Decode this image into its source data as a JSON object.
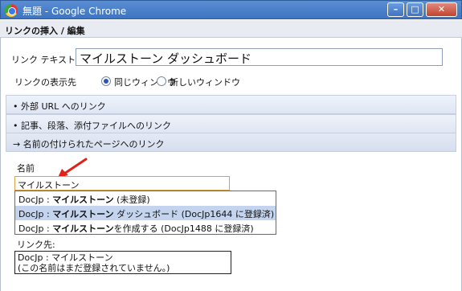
{
  "window": {
    "title": "無題 - Google Chrome",
    "minimize_symbol": "–",
    "maximize_symbol": "□",
    "close_symbol": "✕"
  },
  "dialog": {
    "header": "リンクの挿入 / 編集",
    "link_text_label": "リンク テキスト",
    "link_text_value": "マイルストーン ダッシュボード",
    "display_label": "リンクの表示先",
    "radio_same": "同じウィンドウ",
    "radio_new": "新しいウィンドウ",
    "selected_target": "same"
  },
  "sections": [
    {
      "label": "• 外部 URL へのリンク"
    },
    {
      "label": "• 記事、段落、添付ファイルへのリンク"
    },
    {
      "label": "→ 名前の付けられたページへのリンク"
    }
  ],
  "named_page": {
    "name_label": "名前",
    "name_value": "マイルストーン",
    "suggestions": [
      {
        "prefix": "DocJp : ",
        "bold": "マイルストーン",
        "suffix": " (未登録)"
      },
      {
        "prefix": "DocJp : ",
        "bold": "マイルストーン",
        "suffix": " ダッシュボード (DocJp1644 に登録済)"
      },
      {
        "prefix": "DocJp : ",
        "bold": "マイルストーン",
        "suffix": "を作成する (DocJp1488 に登録済)"
      }
    ],
    "selected_suggestion": 1,
    "link_target_label": "リンク先:",
    "link_target_line1": "DocJp : マイルストーン",
    "link_target_line2": "(この名前はまだ登録されていません。)"
  },
  "colors": {
    "title_bar": "#3e74c1",
    "selection": "#c4d4ef",
    "annotation_arrow": "#e0201a"
  }
}
